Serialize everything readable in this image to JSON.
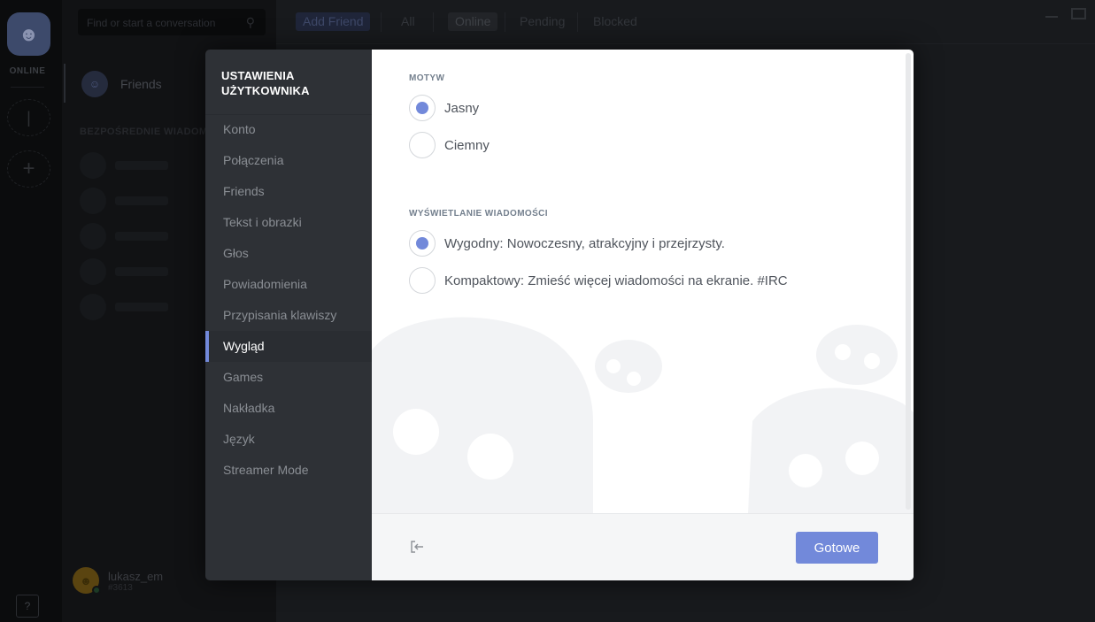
{
  "background": {
    "online_label": "ONLINE",
    "search_placeholder": "Find or start a conversation",
    "friends_label": "Friends",
    "dm_header": "BEZPOŚREDNIE WIADOMOŚCI",
    "help_label": "?",
    "user": {
      "name": "lukasz_em",
      "tag": "#3613"
    },
    "topbar": {
      "add_friend": "Add Friend",
      "tabs": [
        "All",
        "Online",
        "Pending",
        "Blocked"
      ],
      "active_tab": "Online"
    }
  },
  "settings": {
    "title": "USTAWIENIA UŻYTKOWNIKA",
    "menu": [
      "Konto",
      "Połączenia",
      "Friends",
      "Tekst i obrazki",
      "Głos",
      "Powiadomienia",
      "Przypisania klawiszy",
      "Wygląd",
      "Games",
      "Nakładka",
      "Język",
      "Streamer Mode"
    ],
    "active_menu": "Wygląd",
    "theme": {
      "title": "MOTYW",
      "options": [
        "Jasny",
        "Ciemny"
      ],
      "selected": "Jasny"
    },
    "display": {
      "title": "WYŚWIETLANIE WIADOMOŚCI",
      "options": [
        "Wygodny: Nowoczesny, atrakcyjny i przejrzysty.",
        "Kompaktowy: Zmieść więcej wiadomości na ekranie. #IRC"
      ],
      "selected": "Wygodny: Nowoczesny, atrakcyjny i przejrzysty."
    },
    "done_label": "Gotowe"
  },
  "colors": {
    "accent": "#7289da",
    "sidebar_bg": "#2e3136",
    "content_bg": "#ffffff"
  }
}
